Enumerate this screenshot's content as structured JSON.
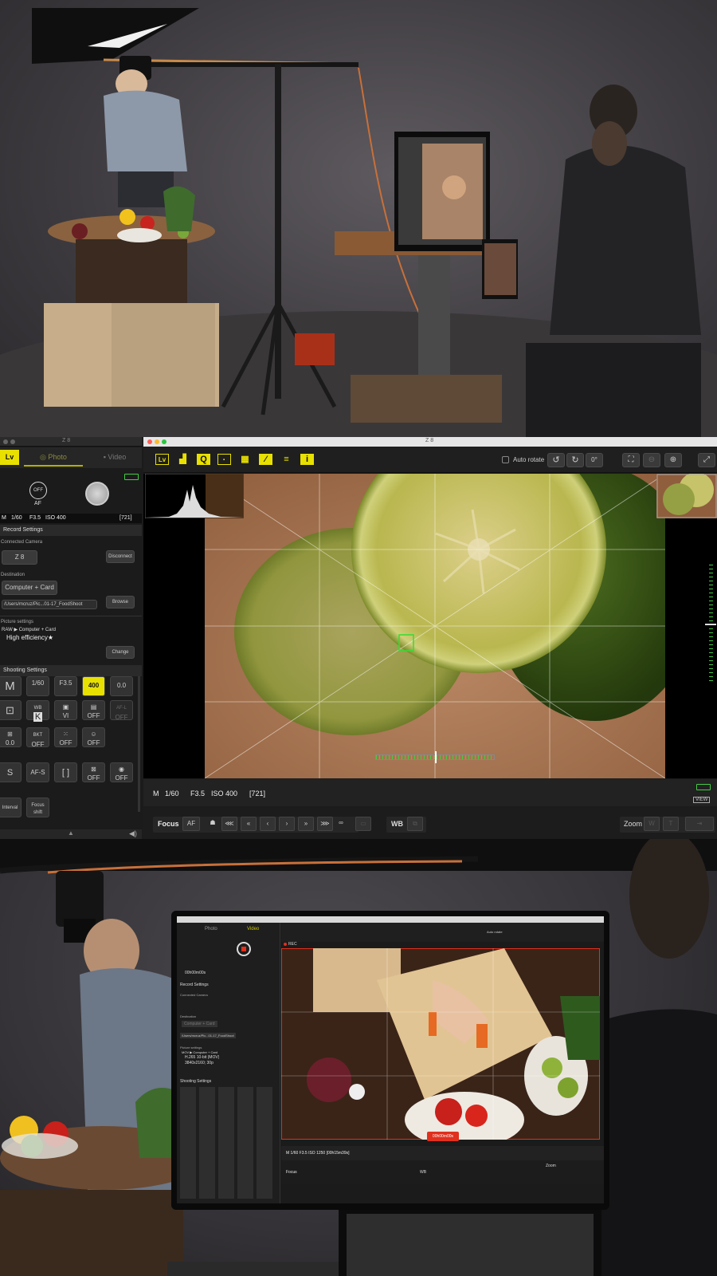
{
  "left_window": {
    "title": "Z 8",
    "lv_label": "Lv",
    "tabs": [
      {
        "label": "Photo"
      },
      {
        "label": "Video"
      }
    ],
    "af_off_label": "OFF",
    "af_label": "AF",
    "status": {
      "mode": "M",
      "shutter": "1/60",
      "aperture": "F3.5",
      "iso": "ISO 400",
      "remaining": "[721]"
    },
    "record_settings": {
      "header": "Record Settings",
      "connected_camera_label": "Connected Camera",
      "camera_name": "Z 8",
      "disconnect_label": "Disconnect",
      "destination_label": "Destination",
      "destination_value": "Computer + Card",
      "path_value": "/Users/mcruz/Pic...01-17_FoodShoot",
      "browse_label": "Browse",
      "picture_settings_label": "Picture settings",
      "picture_line1": "RAW ▶ Computer + Card",
      "picture_line2": "High efficiency★",
      "change_label": "Change"
    },
    "shooting_settings": {
      "header": "Shooting Settings",
      "row1": [
        "M",
        "1/60",
        "F3.5",
        "400",
        "0.0"
      ],
      "row2": [
        "",
        "K",
        "VI",
        "OFF",
        "OFF"
      ],
      "row2_top": [
        "",
        "WB",
        "",
        "",
        "AF-L"
      ],
      "row3": [
        "0.0",
        "OFF",
        "OFF",
        "OFF"
      ],
      "row3_top": [
        "",
        "BKT",
        "",
        ""
      ],
      "row4": [
        "S",
        "AF-S",
        "[ ]",
        "OFF",
        "OFF"
      ],
      "row5": [
        "Interval",
        "Focus shift"
      ]
    }
  },
  "main_window": {
    "title": "Z 8",
    "auto_rotate_label": "Auto rotate",
    "rotate_value": "0°",
    "status": {
      "mode": "M",
      "shutter": "1/60",
      "aperture": "F3.5",
      "iso": "ISO 400",
      "remaining": "[721]"
    },
    "controls": {
      "focus_label": "Focus",
      "af_label": "AF",
      "wb_label": "WB",
      "zoom_label": "Zoom",
      "view_label": "VIEW"
    }
  },
  "bottom_monitor": {
    "tabs": [
      "Photo",
      "Video"
    ],
    "rec_label": "REC",
    "status": "M  1/60  F3.5  ISO 1250  [00h15m39s]",
    "rec_timer": "00h00m00s",
    "record_settings_header": "Record Settings",
    "connected_camera_label": "Connected Camera",
    "destination_label": "Destination",
    "destination_value": "Computer + Card",
    "path_value": "/Users/mcruz/Pic...01-17_FoodShoot",
    "picture_settings_label": "Picture settings",
    "picture_line1": "MOV ▶ Computer + Card",
    "picture_line2": "H.265 10-bit (MOV)",
    "picture_line3": "3840x2160; 30p",
    "shooting_settings_header": "Shooting Settings",
    "auto_rotate_label": "Auto rotate",
    "focus_label": "Focus",
    "wb_label": "WB",
    "zoom_label": "Zoom"
  },
  "colors": {
    "accent": "#e8e000",
    "focus_box": "#33dd33",
    "rec": "#e0301e",
    "battery": "#44cc44"
  }
}
